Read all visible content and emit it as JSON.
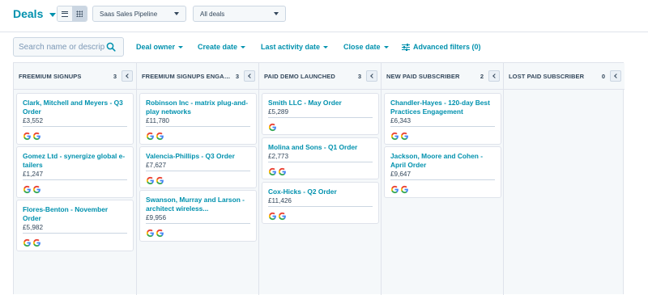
{
  "header": {
    "title": "Deals",
    "pipeline_select": "Saas Sales Pipeline",
    "view_select": "All deals"
  },
  "filters": {
    "search_placeholder": "Search name or descrip",
    "deal_owner": "Deal owner",
    "create_date": "Create date",
    "last_activity_date": "Last activity date",
    "close_date": "Close date",
    "advanced_filters": "Advanced filters (0)"
  },
  "icons": {
    "list_view": "list-icon",
    "board_view": "grid-icon",
    "search": "search-icon",
    "advanced": "sliders-icon",
    "owner": "google-g-icon"
  },
  "colors": {
    "accent": "#0091ae",
    "text": "#33475b",
    "board_bg": "#f5f8fa"
  },
  "columns": [
    {
      "name": "FREEMIUM SIGNUPS",
      "count": "3",
      "cards": [
        {
          "title": "Clark, Mitchell and Meyers - Q3 Order",
          "amount": "£3,552",
          "owners": 2
        },
        {
          "title": "Gomez Ltd - synergize global e-tailers",
          "amount": "£1,247",
          "owners": 2
        },
        {
          "title": "Flores-Benton - November Order",
          "amount": "£5,982",
          "owners": 2
        }
      ]
    },
    {
      "name": "FREEMIUM SIGNUPS ENGAGED",
      "count": "3",
      "cards": [
        {
          "title": "Robinson Inc - matrix plug-and-play networks",
          "amount": "£11,780",
          "owners": 2
        },
        {
          "title": "Valencia-Phillips - Q3 Order",
          "amount": "£7,627",
          "owners": 2
        },
        {
          "title": "Swanson, Murray and Larson - architect wireless...",
          "amount": "£9,956",
          "owners": 2
        }
      ]
    },
    {
      "name": "PAID DEMO LAUNCHED",
      "count": "3",
      "cards": [
        {
          "title": "Smith LLC - May Order",
          "amount": "£5,289",
          "owners": 1
        },
        {
          "title": "Molina and Sons - Q1 Order",
          "amount": "£2,773",
          "owners": 2
        },
        {
          "title": "Cox-Hicks - Q2 Order",
          "amount": "£11,426",
          "owners": 2
        }
      ]
    },
    {
      "name": "NEW PAID SUBSCRIBER",
      "count": "2",
      "cards": [
        {
          "title": "Chandler-Hayes - 120-day Best Practices Engagement",
          "amount": "£6,343",
          "owners": 2
        },
        {
          "title": "Jackson, Moore and Cohen - April Order",
          "amount": "£9,647",
          "owners": 2
        }
      ]
    },
    {
      "name": "LOST PAID SUBSCRIBER",
      "count": "0",
      "cards": []
    }
  ]
}
